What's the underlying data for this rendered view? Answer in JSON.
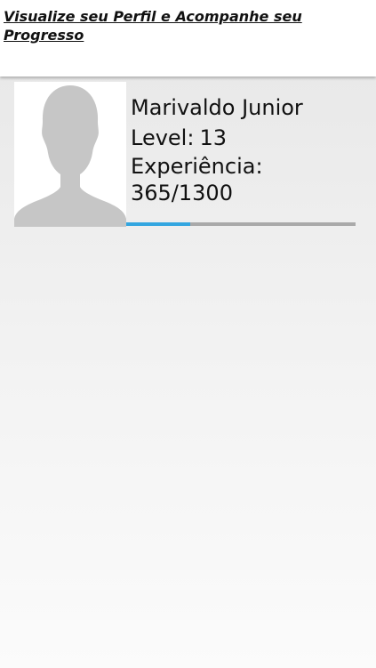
{
  "header": {
    "title": "Visualize seu Perfil e Acompanhe seu Progresso"
  },
  "profile": {
    "name": "Marivaldo Junior",
    "level_label": "Level:",
    "level_value": "13",
    "xp_label": "Experiência:",
    "xp_value": "365/1300",
    "xp_current": 365,
    "xp_total": 1300,
    "avatar_icon": "default-user-silhouette"
  },
  "colors": {
    "progress_fill": "#33a6e0",
    "progress_track": "#a9a9a9",
    "avatar_silhouette": "#c6c6c6"
  }
}
